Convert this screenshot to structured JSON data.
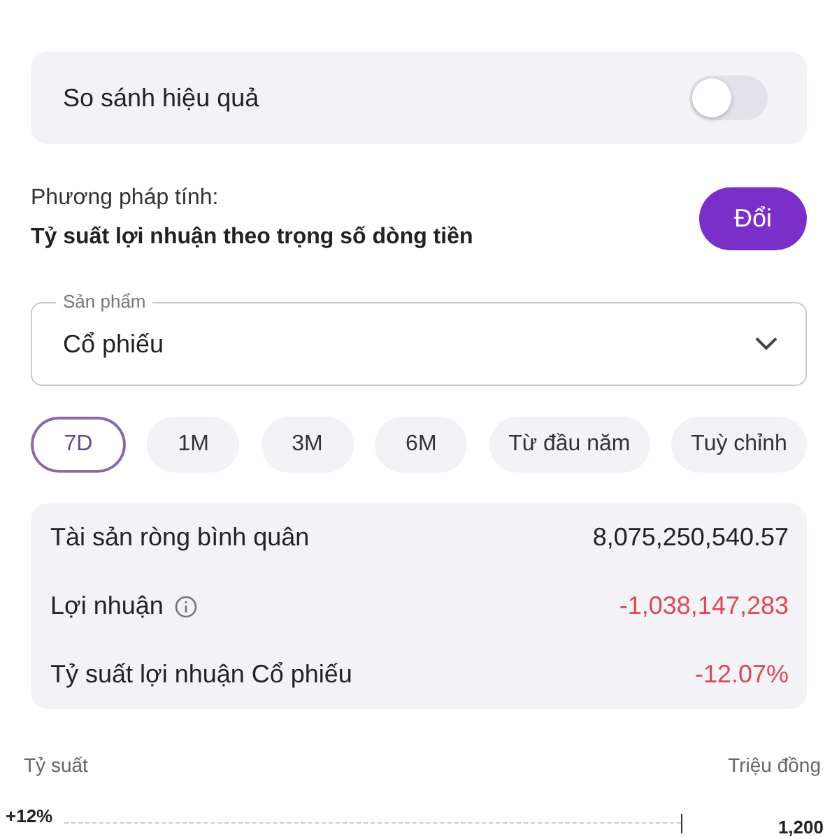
{
  "compare": {
    "label": "So sánh hiệu quả",
    "on": false
  },
  "method": {
    "label": "Phương pháp tính:",
    "value": "Tỷ suất lợi nhuận theo trọng số dòng tiền",
    "button": "Đổi"
  },
  "product": {
    "label": "Sản phẩm",
    "value": "Cổ phiếu"
  },
  "periods": [
    {
      "label": "7D",
      "selected": true
    },
    {
      "label": "1M",
      "selected": false
    },
    {
      "label": "3M",
      "selected": false
    },
    {
      "label": "6M",
      "selected": false
    },
    {
      "label": "Từ đầu năm",
      "selected": false
    },
    {
      "label": "Tuỳ chỉnh",
      "selected": false
    }
  ],
  "stats": [
    {
      "label": "Tài sản ròng bình quân",
      "value": "8,075,250,540.57",
      "negative": false,
      "info": false
    },
    {
      "label": "Lợi nhuận",
      "value": "-1,038,147,283",
      "negative": true,
      "info": true
    },
    {
      "label": "Tỷ suất lợi nhuận Cổ phiếu",
      "value": "-12.07%",
      "negative": true,
      "info": false
    }
  ],
  "chart": {
    "left_axis_title": "Tỷ suất",
    "right_axis_title": "Triệu đồng",
    "left_tick": "+12%",
    "right_tick": "1,200"
  }
}
